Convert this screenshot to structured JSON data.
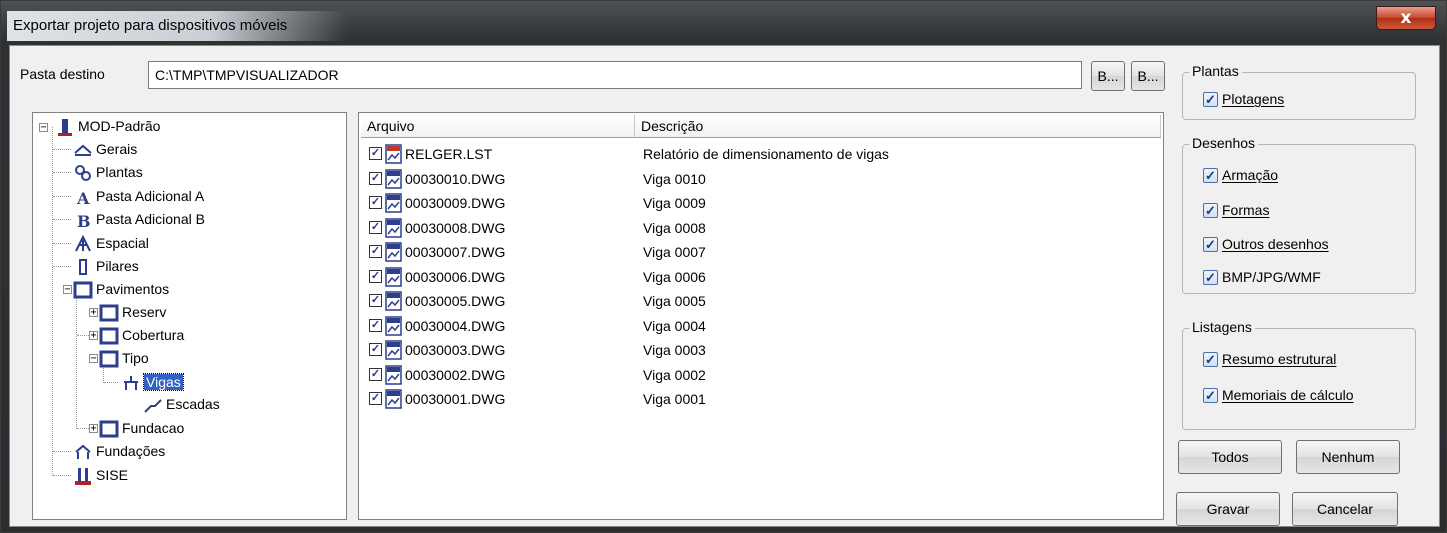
{
  "window": {
    "title": "Exportar projeto para dispositivos móveis",
    "close_label": "x"
  },
  "destination": {
    "label": "Pasta destino",
    "value": "C:\\TMP\\TMPVISUALIZADOR",
    "browse1": "B...",
    "browse2": "B..."
  },
  "tree": {
    "root": "MOD-Padrão",
    "items": [
      "Gerais",
      "Plantas",
      "Pasta Adicional A",
      "Pasta Adicional B",
      "Espacial",
      "Pilares",
      "Pavimentos",
      "Reserv",
      "Cobertura",
      "Tipo",
      "Vigas",
      "Escadas",
      "Fundacao",
      "Fundações",
      "SISE"
    ]
  },
  "list": {
    "columns": [
      "Arquivo",
      "Descrição"
    ],
    "rows": [
      {
        "file": "RELGER.LST",
        "desc": "Relatório de dimensionamento de vigas",
        "checked": true
      },
      {
        "file": "00030010.DWG",
        "desc": "Viga 0010",
        "checked": true
      },
      {
        "file": "00030009.DWG",
        "desc": "Viga 0009",
        "checked": true
      },
      {
        "file": "00030008.DWG",
        "desc": "Viga 0008",
        "checked": true
      },
      {
        "file": "00030007.DWG",
        "desc": "Viga 0007",
        "checked": true
      },
      {
        "file": "00030006.DWG",
        "desc": "Viga 0006",
        "checked": true
      },
      {
        "file": "00030005.DWG",
        "desc": "Viga 0005",
        "checked": true
      },
      {
        "file": "00030004.DWG",
        "desc": "Viga 0004",
        "checked": true
      },
      {
        "file": "00030003.DWG",
        "desc": "Viga 0003",
        "checked": true
      },
      {
        "file": "00030002.DWG",
        "desc": "Viga 0002",
        "checked": true
      },
      {
        "file": "00030001.DWG",
        "desc": "Viga 0001",
        "checked": true
      }
    ]
  },
  "plantas": {
    "title": "Plantas",
    "plotagens": "Plotagens"
  },
  "desenhos": {
    "title": "Desenhos",
    "armacao": "Armação",
    "formas": "Formas",
    "outros": "Outros desenhos",
    "bmp": "BMP/JPG/WMF"
  },
  "listagens": {
    "title": "Listagens",
    "resumo": "Resumo estrutural",
    "memoriais": "Memoriais de cálculo"
  },
  "buttons": {
    "todos": "Todos",
    "nenhum": "Nenhum",
    "gravar": "Gravar",
    "cancelar": "Cancelar"
  },
  "colors": {
    "selection": "#3162c4",
    "close": "#c8452b"
  }
}
